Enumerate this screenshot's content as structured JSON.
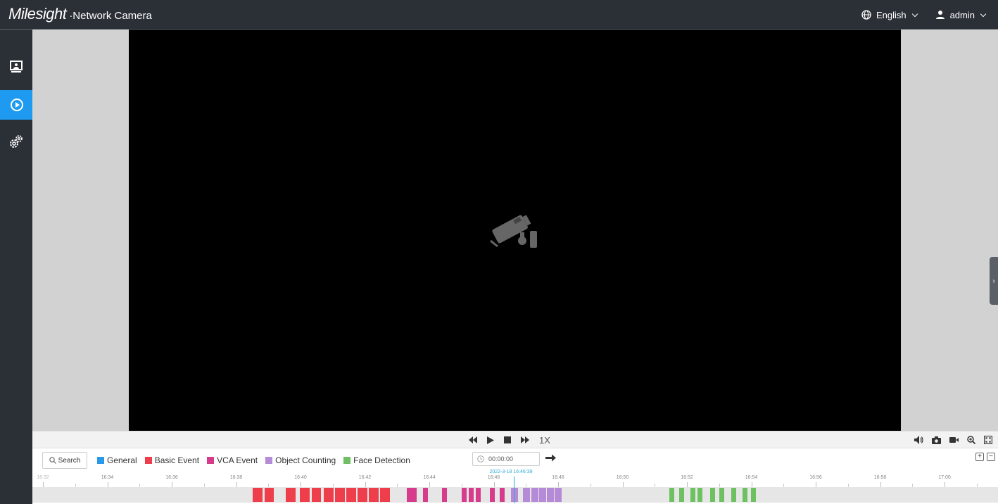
{
  "header": {
    "brand_logo": "Milesight",
    "brand_product": "·Network Camera",
    "language_label": "English",
    "user_label": "admin"
  },
  "sidebar": {
    "items": [
      {
        "icon": "live-view-icon",
        "active": false
      },
      {
        "icon": "playback-icon",
        "active": true
      },
      {
        "icon": "settings-icon",
        "active": false
      }
    ]
  },
  "video": {
    "placeholder_icon": "no-camera-icon"
  },
  "controls": {
    "speed_label": "1X"
  },
  "timeline": {
    "search_label": "Search",
    "legend": [
      {
        "label": "General",
        "color": "#2a9ae8"
      },
      {
        "label": "Basic Event",
        "color": "#ee3e4c"
      },
      {
        "label": "VCA Event",
        "color": "#d63b8c"
      },
      {
        "label": "Object Counting",
        "color": "#b58ad6"
      },
      {
        "label": "Face Detection",
        "color": "#6dc160"
      }
    ],
    "time_value": "00:00:00",
    "cursor_time": "2022-3-18 16:46:39",
    "ticks": [
      "16:32",
      "16:34",
      "16:36",
      "16:38",
      "16:40",
      "16:42",
      "16:44",
      "16:46",
      "16:48",
      "16:50",
      "16:52",
      "16:54",
      "16:56",
      "16:58",
      "17:00"
    ]
  }
}
